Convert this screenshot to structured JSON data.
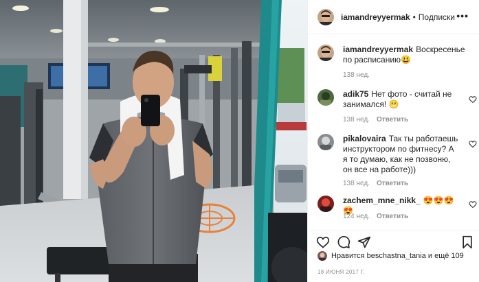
{
  "post": {
    "author": "iamandreyyermak",
    "separator": "•",
    "follow_label": "Подписки",
    "more_label": "•••"
  },
  "comments": [
    {
      "username": "iamandreyyermak",
      "text": "Воскресенье по расписанию😃",
      "time": "138 нед.",
      "reply": ""
    },
    {
      "username": "adik75",
      "text": "Нет фото - считай не занимался! 😬",
      "time": "138 нед.",
      "reply": "Ответить"
    },
    {
      "username": "pikalovaira",
      "text": "Так ты работаешь инструктором по фитнесу? А я то думаю, как не позвоню, он все на работе)))",
      "time": "138 нед.",
      "reply": "Ответить"
    },
    {
      "username": "zachem_mne_nikk_",
      "text": "😍😍😍😍",
      "time": "124 нед.",
      "reply": "Ответить"
    }
  ],
  "likes": {
    "text": "Нравится beschastna_tania и ещё 109"
  },
  "date": "18 ИЮНЯ 2017 Г.",
  "colors": {
    "accent": "#262626",
    "muted": "#8e8e8e",
    "border": "#efefef",
    "floor_mark": "#e8823a"
  }
}
